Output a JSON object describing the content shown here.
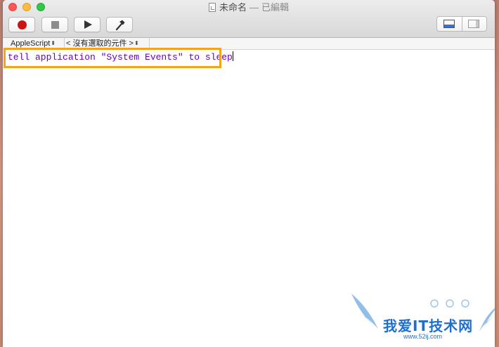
{
  "window": {
    "title": "未命名",
    "title_separator": "—",
    "status": "已編輯"
  },
  "toolbar": {
    "buttons": [
      {
        "id": "record",
        "icon": "record-icon"
      },
      {
        "id": "stop",
        "icon": "stop-icon"
      },
      {
        "id": "run",
        "icon": "play-icon"
      },
      {
        "id": "compile",
        "icon": "hammer-icon"
      }
    ],
    "view_toggle": [
      {
        "id": "bottom-pane",
        "icon": "bottom-pane-icon",
        "selected": true
      },
      {
        "id": "side-pane",
        "icon": "side-pane-icon",
        "selected": false
      }
    ]
  },
  "navbar": {
    "language": "AppleScript",
    "element": "< 沒有選取的元件 >"
  },
  "editor": {
    "code": "tell application \"System Events\" to sleep"
  },
  "colors": {
    "code_text": "#6e00b4",
    "highlight": "#f3a41c",
    "record": "#cf1313",
    "watermark": "#1e6fd0"
  },
  "watermark": {
    "text": "我爱IT技术网",
    "url": "www.52ij.com"
  }
}
